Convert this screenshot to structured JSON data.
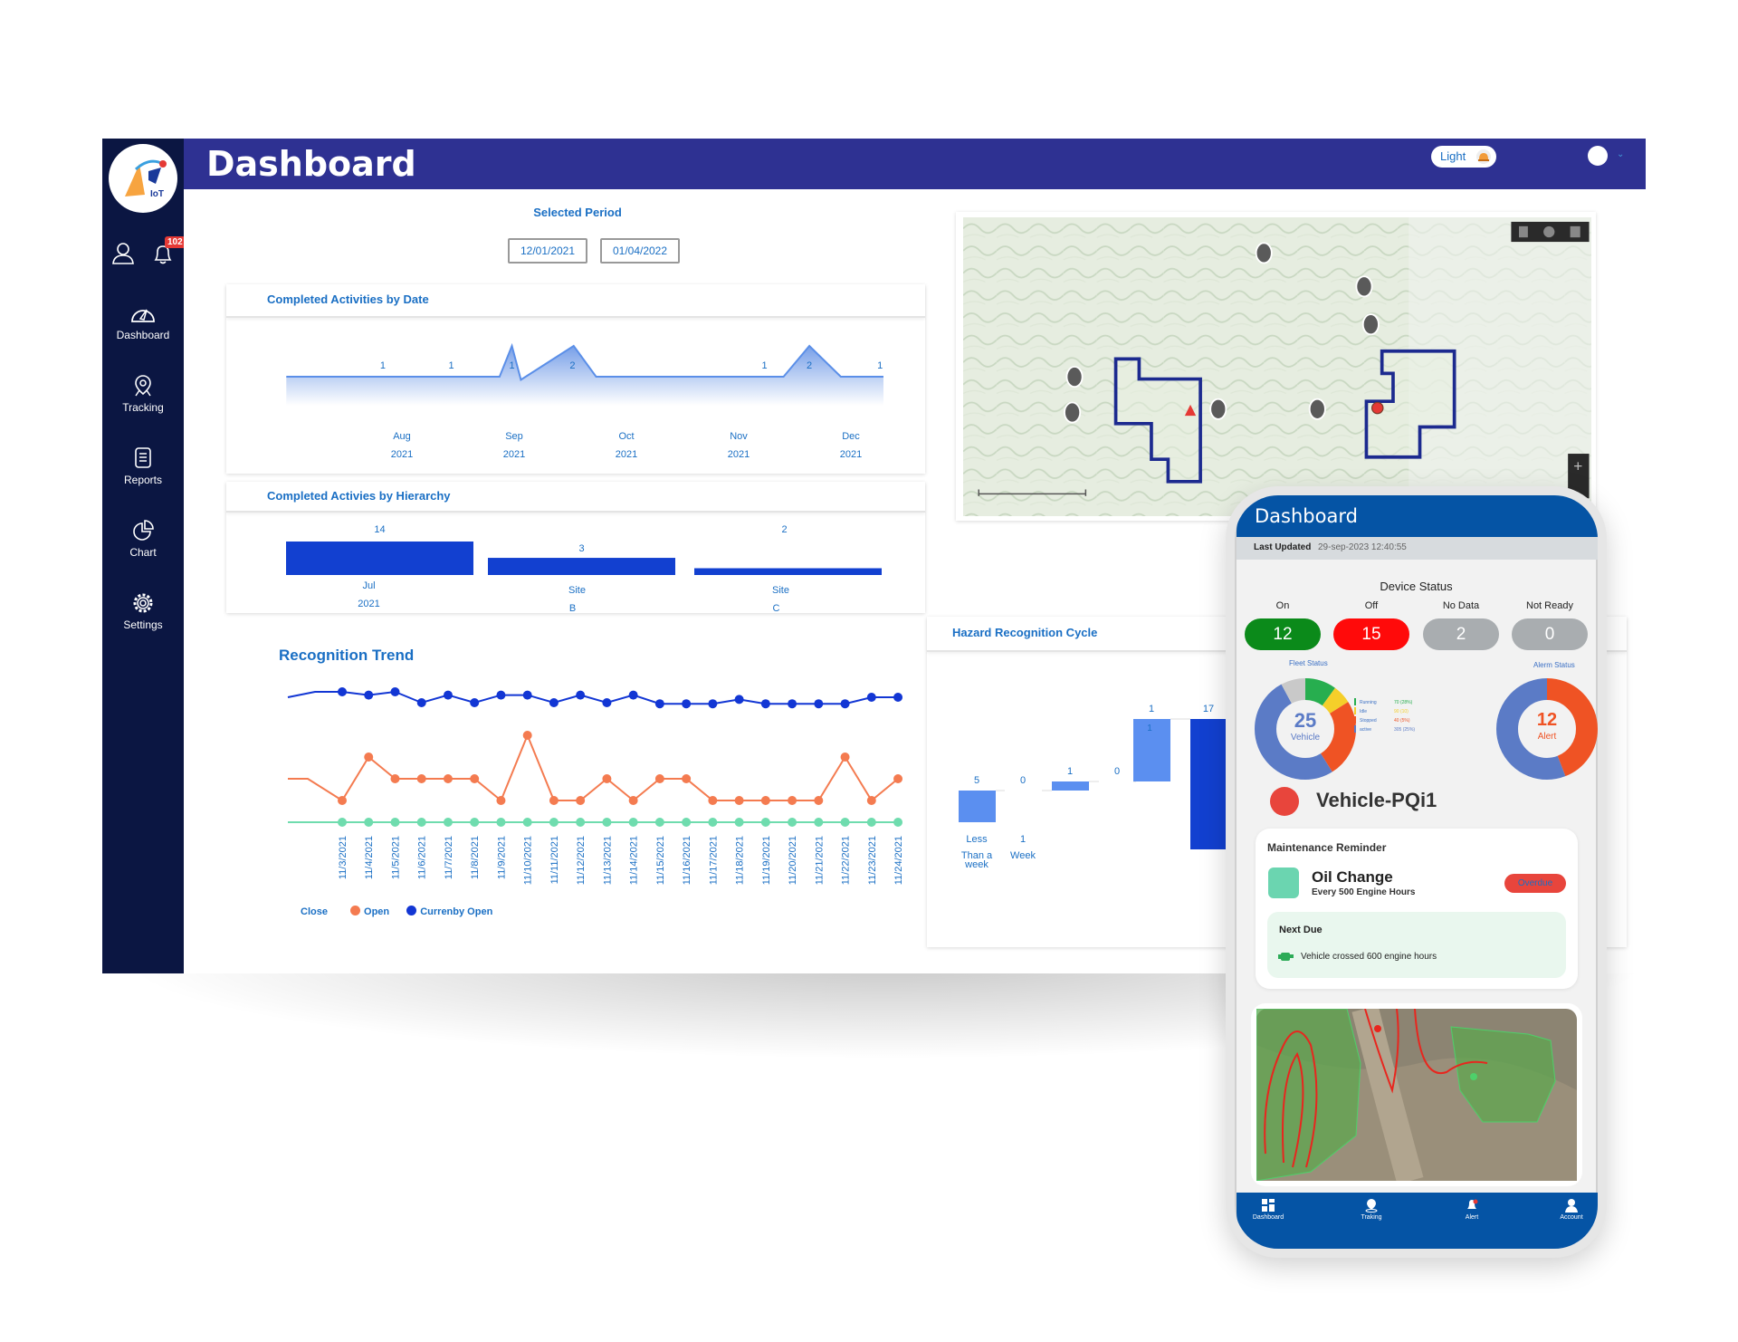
{
  "header": {
    "title": "Dashboard",
    "theme_toggle": "Light"
  },
  "sidebar": {
    "notification_count": "102",
    "items": [
      {
        "label": "Dashboard",
        "icon": "speedometer-icon"
      },
      {
        "label": "Tracking",
        "icon": "location-pin-icon"
      },
      {
        "label": "Reports",
        "icon": "document-icon"
      },
      {
        "label": "Chart",
        "icon": "pie-chart-icon"
      },
      {
        "label": "Settings",
        "icon": "gear-icon"
      }
    ]
  },
  "period": {
    "label": "Selected Period",
    "start": "12/01/2021",
    "end": "01/04/2022"
  },
  "colors": {
    "header": "#2e3192",
    "sidebar": "#0b1642",
    "accent": "#1a6fc4",
    "bar": "#1240d0",
    "open": "#f47b50",
    "current_open": "#1236d4",
    "close": "#6fdcae"
  },
  "chart_data": [
    {
      "type": "area",
      "title": "Completed Activities by Date",
      "ticks": [
        {
          "m": 8,
          "month": "Aug",
          "year": "2021"
        },
        {
          "m": 9,
          "month": "Sep",
          "year": "2021"
        },
        {
          "m": 10,
          "month": "Oct",
          "year": "2021"
        },
        {
          "m": 11,
          "month": "Nov",
          "year": "2021"
        },
        {
          "m": 12,
          "month": "Dec",
          "year": "2021"
        }
      ],
      "points": [
        [
          6.97,
          1
        ],
        [
          8.87,
          1
        ],
        [
          8.98,
          2
        ],
        [
          9.06,
          0.9
        ],
        [
          9.53,
          2
        ],
        [
          9.73,
          1
        ],
        [
          11.4,
          1
        ],
        [
          11.63,
          2
        ],
        [
          11.91,
          1
        ],
        [
          12.29,
          1
        ]
      ],
      "data_labels": [
        {
          "m": 7.83,
          "text": "1"
        },
        {
          "m": 8.44,
          "text": "1"
        },
        {
          "m": 8.98,
          "text": "1"
        },
        {
          "m": 9.52,
          "text": "2"
        },
        {
          "m": 11.23,
          "text": "1"
        },
        {
          "m": 11.63,
          "text": "2"
        },
        {
          "m": 12.26,
          "text": "1"
        }
      ]
    },
    {
      "type": "bar",
      "title": "Completed Activies by Hierarchy",
      "categories": [
        [
          "Jul",
          "2021"
        ],
        [
          "Site",
          "B"
        ],
        [
          "Site",
          "C"
        ]
      ],
      "values": [
        14,
        3,
        2
      ]
    },
    {
      "type": "line",
      "title": "Recognition Trend",
      "x": [
        "11/3/2021",
        "11/4/2021",
        "11/5/2021",
        "11/6/2021",
        "11/7/2021",
        "11/8/2021",
        "11/9/2021",
        "11/10/2021",
        "11/11/2021",
        "11/12/2021",
        "11/13/2021",
        "11/14/2021",
        "11/15/2021",
        "11/16/2021",
        "11/17/2021",
        "11/18/2021",
        "11/19/2021",
        "11/20/2021",
        "11/21/2021",
        "11/22/2021",
        "11/23/2021",
        "11/24/2021"
      ],
      "series": [
        {
          "name": "Close",
          "color": "#6fdcae",
          "values": [
            0,
            0,
            0,
            0,
            0,
            0,
            0,
            0,
            0,
            0,
            0,
            0,
            0,
            0,
            0,
            0,
            0,
            0,
            0,
            0,
            0,
            0
          ]
        },
        {
          "name": "Open",
          "color": "#f47b50",
          "values": [
            2,
            6,
            4,
            4,
            4,
            4,
            2,
            8,
            2,
            2,
            4,
            2,
            4,
            4,
            2,
            2,
            2,
            2,
            2,
            6,
            2,
            4
          ]
        },
        {
          "name": "Currenby Open",
          "color": "#1236d4",
          "values": [
            12,
            11.7,
            12,
            11,
            11.7,
            11,
            11.7,
            11.7,
            11,
            11.7,
            11,
            11.7,
            10.9,
            10.9,
            10.9,
            11.3,
            10.9,
            10.9,
            10.9,
            10.9,
            11.5,
            11.5
          ]
        }
      ],
      "legend": "bottom-left"
    },
    {
      "type": "bar",
      "title": "Hazard Recognition Cycle",
      "categories": [
        [
          "Less",
          "Than a",
          "week"
        ],
        [
          "1",
          "Week"
        ],
        [],
        [],
        [],
        []
      ],
      "values": [
        5,
        0,
        1,
        0,
        1,
        17
      ],
      "inner_labels": [
        "",
        "",
        "",
        "",
        "1",
        ""
      ]
    }
  ],
  "mobile": {
    "title": "Dashboard",
    "last_updated_label": "Last Updated",
    "last_updated_value": "29-sep-2023  12:40:55",
    "device_status": {
      "title": "Device Status",
      "items": [
        {
          "label": "On",
          "value": "12",
          "color": "#0b8a1a"
        },
        {
          "label": "Off",
          "value": "15",
          "color": "#ff0a0a"
        },
        {
          "label": "No Data",
          "value": "2",
          "color": "#a9adb0"
        },
        {
          "label": "Not Ready",
          "value": "0",
          "color": "#a9adb0"
        }
      ]
    },
    "fleet": {
      "title": "Fleet Status",
      "count": "25",
      "unit": "Vehicle",
      "segments": [
        {
          "name": "Running",
          "value": "70 (28%)",
          "share": 10,
          "color": "#27ae4f"
        },
        {
          "name": "Idle",
          "value": "90 (10)",
          "share": 6,
          "color": "#f5cf2a"
        },
        {
          "name": "Stopped",
          "value": "40 (5%)",
          "share": 25,
          "color": "#ef5324"
        },
        {
          "name": "active",
          "value": "305 (25%)",
          "share": 51,
          "color": "#5b7bc6"
        },
        {
          "name": "",
          "value": "",
          "share": 8,
          "color": "#c9c9c9"
        }
      ]
    },
    "alarm": {
      "title": "Alerm Status",
      "count": "12",
      "unit": "Alert",
      "segments": [
        {
          "share": 44,
          "color": "#ef5324"
        },
        {
          "share": 56,
          "color": "#5b7bc6"
        }
      ]
    },
    "vehicle_name": "Vehicle-PQi1",
    "maintenance": {
      "title": "Maintenance Reminder",
      "task": "Oil Change",
      "interval": "Every 500 Engine Hours",
      "status": "Overdue",
      "next_due_label": "Next Due",
      "next_due_text": "Vehicle crossed 600 engine hours"
    },
    "tabs": [
      {
        "label": "Dashboard",
        "icon": "grid-icon"
      },
      {
        "label": "Traking",
        "icon": "location-pin-icon"
      },
      {
        "label": "Alert",
        "icon": "bell-icon"
      },
      {
        "label": "Account",
        "icon": "user-icon"
      }
    ]
  }
}
